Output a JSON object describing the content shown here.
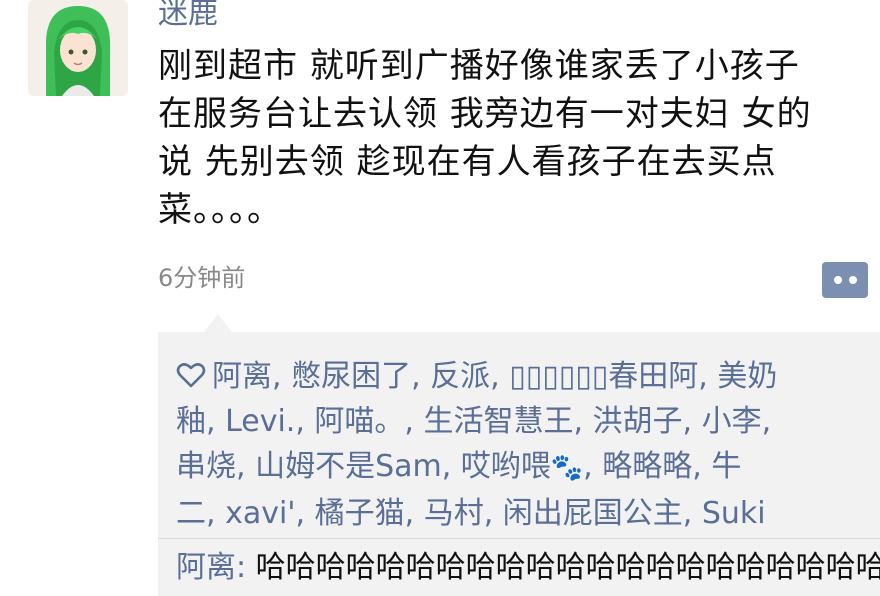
{
  "post": {
    "username": "迷鹿",
    "avatar_icon": "green-haired-girl-avatar",
    "text_lines": [
      "刚到超市 就听到广播好像谁家丢了小孩子",
      "在服务台让去认领 我旁边有一对夫妇 女的",
      "说 先别去领 趁现在有人看孩子在去买点",
      "菜。。。。"
    ],
    "timestamp": "6分钟前",
    "comment_button_icon": "comment-dots-icon"
  },
  "likes": {
    "icon": "heart-outline-icon",
    "lines": [
      "阿离, 憋尿困了, 反派, ▯▯▯▯▯▯春田阿, 美奶",
      "釉, Levi., 阿喵。, 生活智慧王, 洪胡子, 小李,",
      "串烧, 山姆不是Sam, 哎哟喂",
      ", 略略略, 牛",
      "二, xavi', 橘子猫, 马村, 闲出屁国公主, Suki"
    ],
    "paw_glyph": "🐾",
    "paw_icon": "paw-prints-icon",
    "accent_color": "#5a6e96"
  },
  "comments": [
    {
      "author": "阿离:",
      "text": "哈哈哈哈哈哈哈哈哈哈哈哈哈哈哈哈哈哈哈哈哈"
    }
  ]
}
